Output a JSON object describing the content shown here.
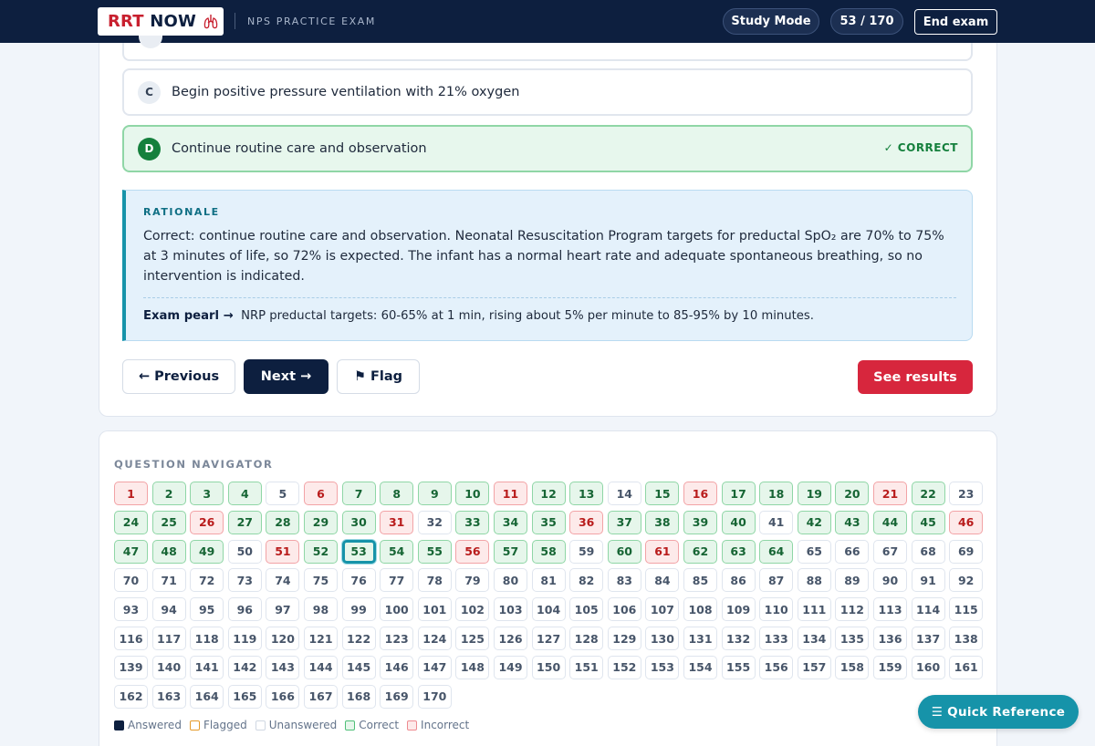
{
  "header": {
    "logo_brand": "RRT",
    "logo_now": "NOW",
    "exam_title": "NPS PRACTICE EXAM",
    "mode_label": "Study Mode",
    "progress_label": "53 / 170",
    "end_label": "End exam"
  },
  "question": {
    "options": [
      {
        "letter": "C",
        "text": "Begin positive pressure ventilation with 21% oxygen",
        "state": "default"
      },
      {
        "letter": "D",
        "text": "Continue routine care and observation",
        "state": "correct",
        "tag": "✓ CORRECT"
      }
    ]
  },
  "rationale": {
    "label": "RATIONALE",
    "text": "Correct: continue routine care and observation. Neonatal Resuscitation Program targets for preductal SpO₂ are 70% to 75% at 3 minutes of life, so 72% is expected. The infant has a normal heart rate and adequate spontaneous breathing, so no intervention is indicated.",
    "pearl_label": "Exam pearl →",
    "pearl_text": "NRP preductal targets: 60-65% at 1 min, rising about 5% per minute to 85-95% by 10 minutes."
  },
  "actions": {
    "previous": "← Previous",
    "next": "Next →",
    "flag": "⚑ Flag",
    "results": "See results"
  },
  "navigator": {
    "title": "QUESTION NAVIGATOR",
    "total": 170,
    "per_row": 23,
    "current": 53,
    "correct": [
      2,
      3,
      4,
      7,
      8,
      9,
      10,
      12,
      13,
      15,
      17,
      18,
      19,
      20,
      22,
      24,
      25,
      27,
      28,
      29,
      30,
      33,
      34,
      35,
      37,
      38,
      39,
      40,
      42,
      43,
      44,
      45,
      47,
      48,
      49,
      52,
      53,
      54,
      55,
      57,
      58,
      60,
      62,
      63,
      64
    ],
    "incorrect": [
      1,
      6,
      11,
      16,
      21,
      26,
      31,
      36,
      46,
      51,
      56,
      61
    ],
    "legend": [
      "Answered",
      "Flagged",
      "Unanswered",
      "Correct",
      "Incorrect"
    ]
  },
  "quick_reference": "☰ Quick Reference",
  "colors": {
    "navy": "#0d1f3f",
    "teal": "#1693a9",
    "correct_green": "#15803d",
    "incorrect_red": "#b91c1c",
    "results_red": "#d7263d"
  }
}
